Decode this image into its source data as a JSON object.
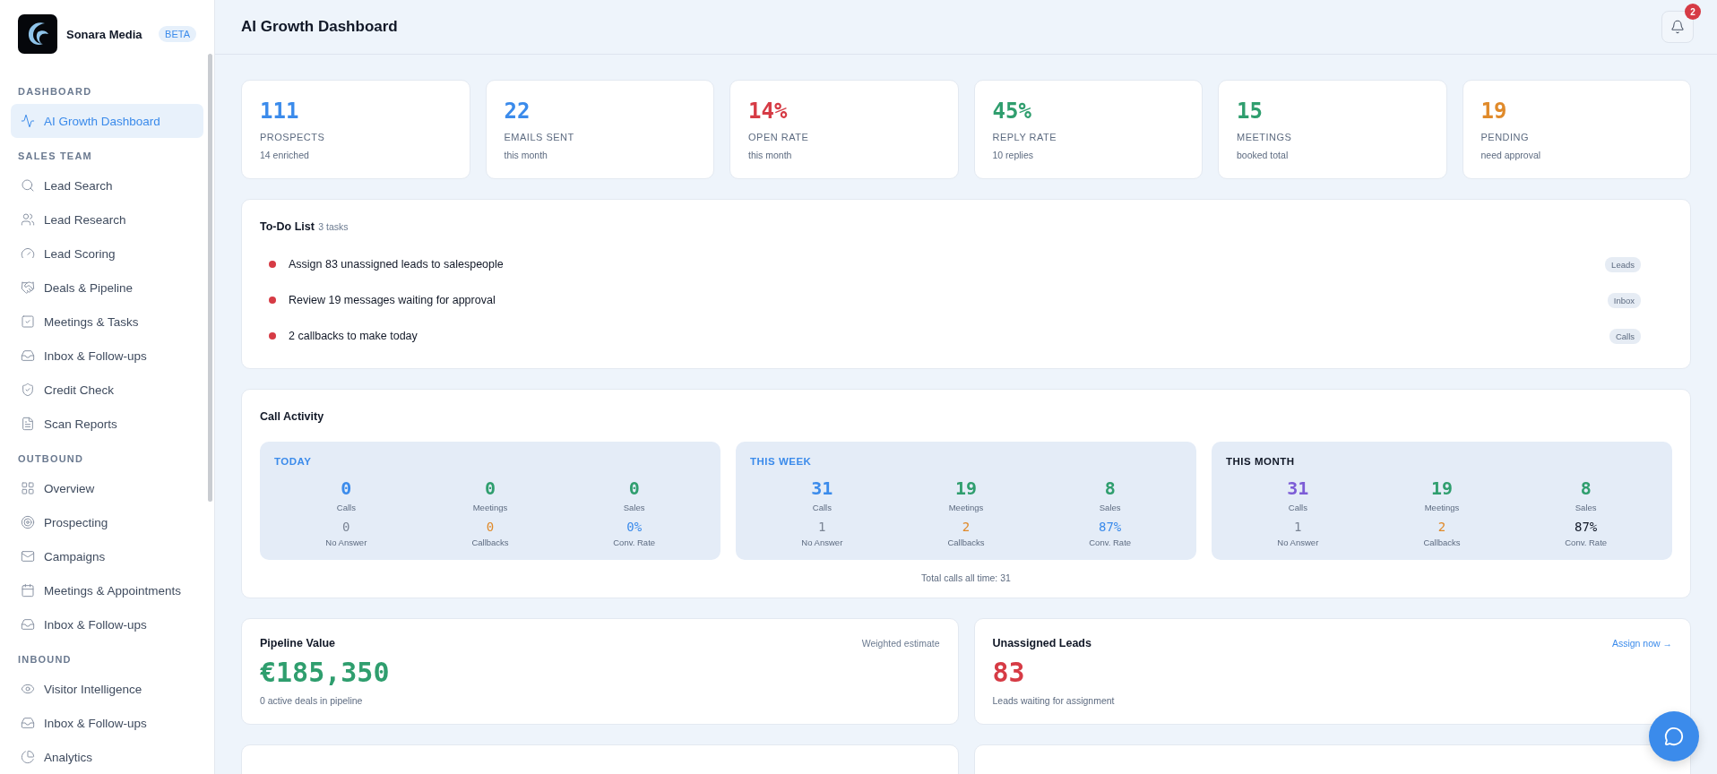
{
  "brand": {
    "name": "Sonara Media",
    "badge": "BETA"
  },
  "sidebar": {
    "sections": [
      {
        "title": "DASHBOARD",
        "items": [
          {
            "label": "AI Growth Dashboard",
            "kind": "activity",
            "selected": true
          }
        ]
      },
      {
        "title": "SALES TEAM",
        "items": [
          {
            "label": "Lead Search",
            "kind": "search",
            "selected": false
          },
          {
            "label": "Lead Research",
            "kind": "users",
            "selected": false
          },
          {
            "label": "Lead Scoring",
            "kind": "gauge",
            "selected": false
          },
          {
            "label": "Deals & Pipeline",
            "kind": "handshake",
            "selected": false
          },
          {
            "label": "Meetings & Tasks",
            "kind": "check",
            "selected": false
          },
          {
            "label": "Inbox & Follow-ups",
            "kind": "inbox",
            "selected": false
          },
          {
            "label": "Credit Check",
            "kind": "shield",
            "selected": false
          },
          {
            "label": "Scan Reports",
            "kind": "file",
            "selected": false
          }
        ]
      },
      {
        "title": "OUTBOUND",
        "items": [
          {
            "label": "Overview",
            "kind": "grid",
            "selected": false
          },
          {
            "label": "Prospecting",
            "kind": "target",
            "selected": false
          },
          {
            "label": "Campaigns",
            "kind": "mail",
            "selected": false
          },
          {
            "label": "Meetings & Appointments",
            "kind": "calendar",
            "selected": false
          },
          {
            "label": "Inbox & Follow-ups",
            "kind": "inbox",
            "selected": false
          }
        ]
      },
      {
        "title": "INBOUND",
        "items": [
          {
            "label": "Visitor Intelligence",
            "kind": "eye",
            "selected": false
          },
          {
            "label": "Inbox & Follow-ups",
            "kind": "inbox",
            "selected": false
          },
          {
            "label": "Analytics",
            "kind": "pie",
            "selected": false
          }
        ]
      }
    ]
  },
  "header": {
    "title": "AI Growth Dashboard",
    "notifications": "2"
  },
  "stats": [
    {
      "value": "111",
      "label": "PROSPECTS",
      "note": "14 enriched",
      "color": "#3b8beb"
    },
    {
      "value": "22",
      "label": "EMAILS SENT",
      "note": "this month",
      "color": "#3b8beb"
    },
    {
      "value": "14%",
      "label": "OPEN RATE",
      "note": "this month",
      "color": "#d63b45"
    },
    {
      "value": "45%",
      "label": "REPLY RATE",
      "note": "10 replies",
      "color": "#2f9e6e"
    },
    {
      "value": "15",
      "label": "MEETINGS",
      "note": "booked total",
      "color": "#2f9e6e"
    },
    {
      "value": "19",
      "label": "PENDING",
      "note": "need approval",
      "color": "#e08a2a"
    }
  ],
  "todo": {
    "title": "To-Do List",
    "count": "3 tasks",
    "items": [
      {
        "text": "Assign 83 unassigned leads to salespeople",
        "tag": "Leads",
        "color": "#d63b45"
      },
      {
        "text": "Review 19 messages waiting for approval",
        "tag": "Inbox",
        "color": "#d63b45"
      },
      {
        "text": "2 callbacks to make today",
        "tag": "Calls",
        "color": "#d63b45"
      }
    ]
  },
  "call_activity": {
    "title": "Call Activity",
    "total": "Total calls all time: 31",
    "periods": [
      {
        "title": "TODAY",
        "color": "#3b8beb",
        "metrics": [
          {
            "value": "0",
            "label": "Calls",
            "color": "#3b8beb"
          },
          {
            "value": "0",
            "label": "Meetings",
            "color": "#2f9e6e"
          },
          {
            "value": "0",
            "label": "Sales",
            "color": "#2f9e6e"
          },
          {
            "value": "0",
            "label": "No Answer",
            "color": "#7a8494"
          },
          {
            "value": "0",
            "label": "Callbacks",
            "color": "#e08a2a"
          },
          {
            "value": "0%",
            "label": "Conv. Rate",
            "color": "#3b8beb"
          }
        ]
      },
      {
        "title": "THIS WEEK",
        "color": "#3b8beb",
        "metrics": [
          {
            "value": "31",
            "label": "Calls",
            "color": "#3b8beb"
          },
          {
            "value": "19",
            "label": "Meetings",
            "color": "#2f9e6e"
          },
          {
            "value": "8",
            "label": "Sales",
            "color": "#2f9e6e"
          },
          {
            "value": "1",
            "label": "No Answer",
            "color": "#7a8494"
          },
          {
            "value": "2",
            "label": "Callbacks",
            "color": "#e08a2a"
          },
          {
            "value": "87%",
            "label": "Conv. Rate",
            "color": "#3b8beb"
          }
        ]
      },
      {
        "title": "THIS MONTH",
        "color": "#111827",
        "metrics": [
          {
            "value": "31",
            "label": "Calls",
            "color": "#7c5cd6"
          },
          {
            "value": "19",
            "label": "Meetings",
            "color": "#2f9e6e"
          },
          {
            "value": "8",
            "label": "Sales",
            "color": "#2f9e6e"
          },
          {
            "value": "1",
            "label": "No Answer",
            "color": "#7a8494"
          },
          {
            "value": "2",
            "label": "Callbacks",
            "color": "#e08a2a"
          },
          {
            "value": "87%",
            "label": "Conv. Rate",
            "color": "#111827"
          }
        ]
      }
    ]
  },
  "pipeline": {
    "title": "Pipeline Value",
    "note": "Weighted estimate",
    "value": "€185,350",
    "caption": "0 active deals in pipeline"
  },
  "unassigned": {
    "title": "Unassigned Leads",
    "link": "Assign now →",
    "value": "83",
    "caption": "Leads waiting for assignment"
  }
}
